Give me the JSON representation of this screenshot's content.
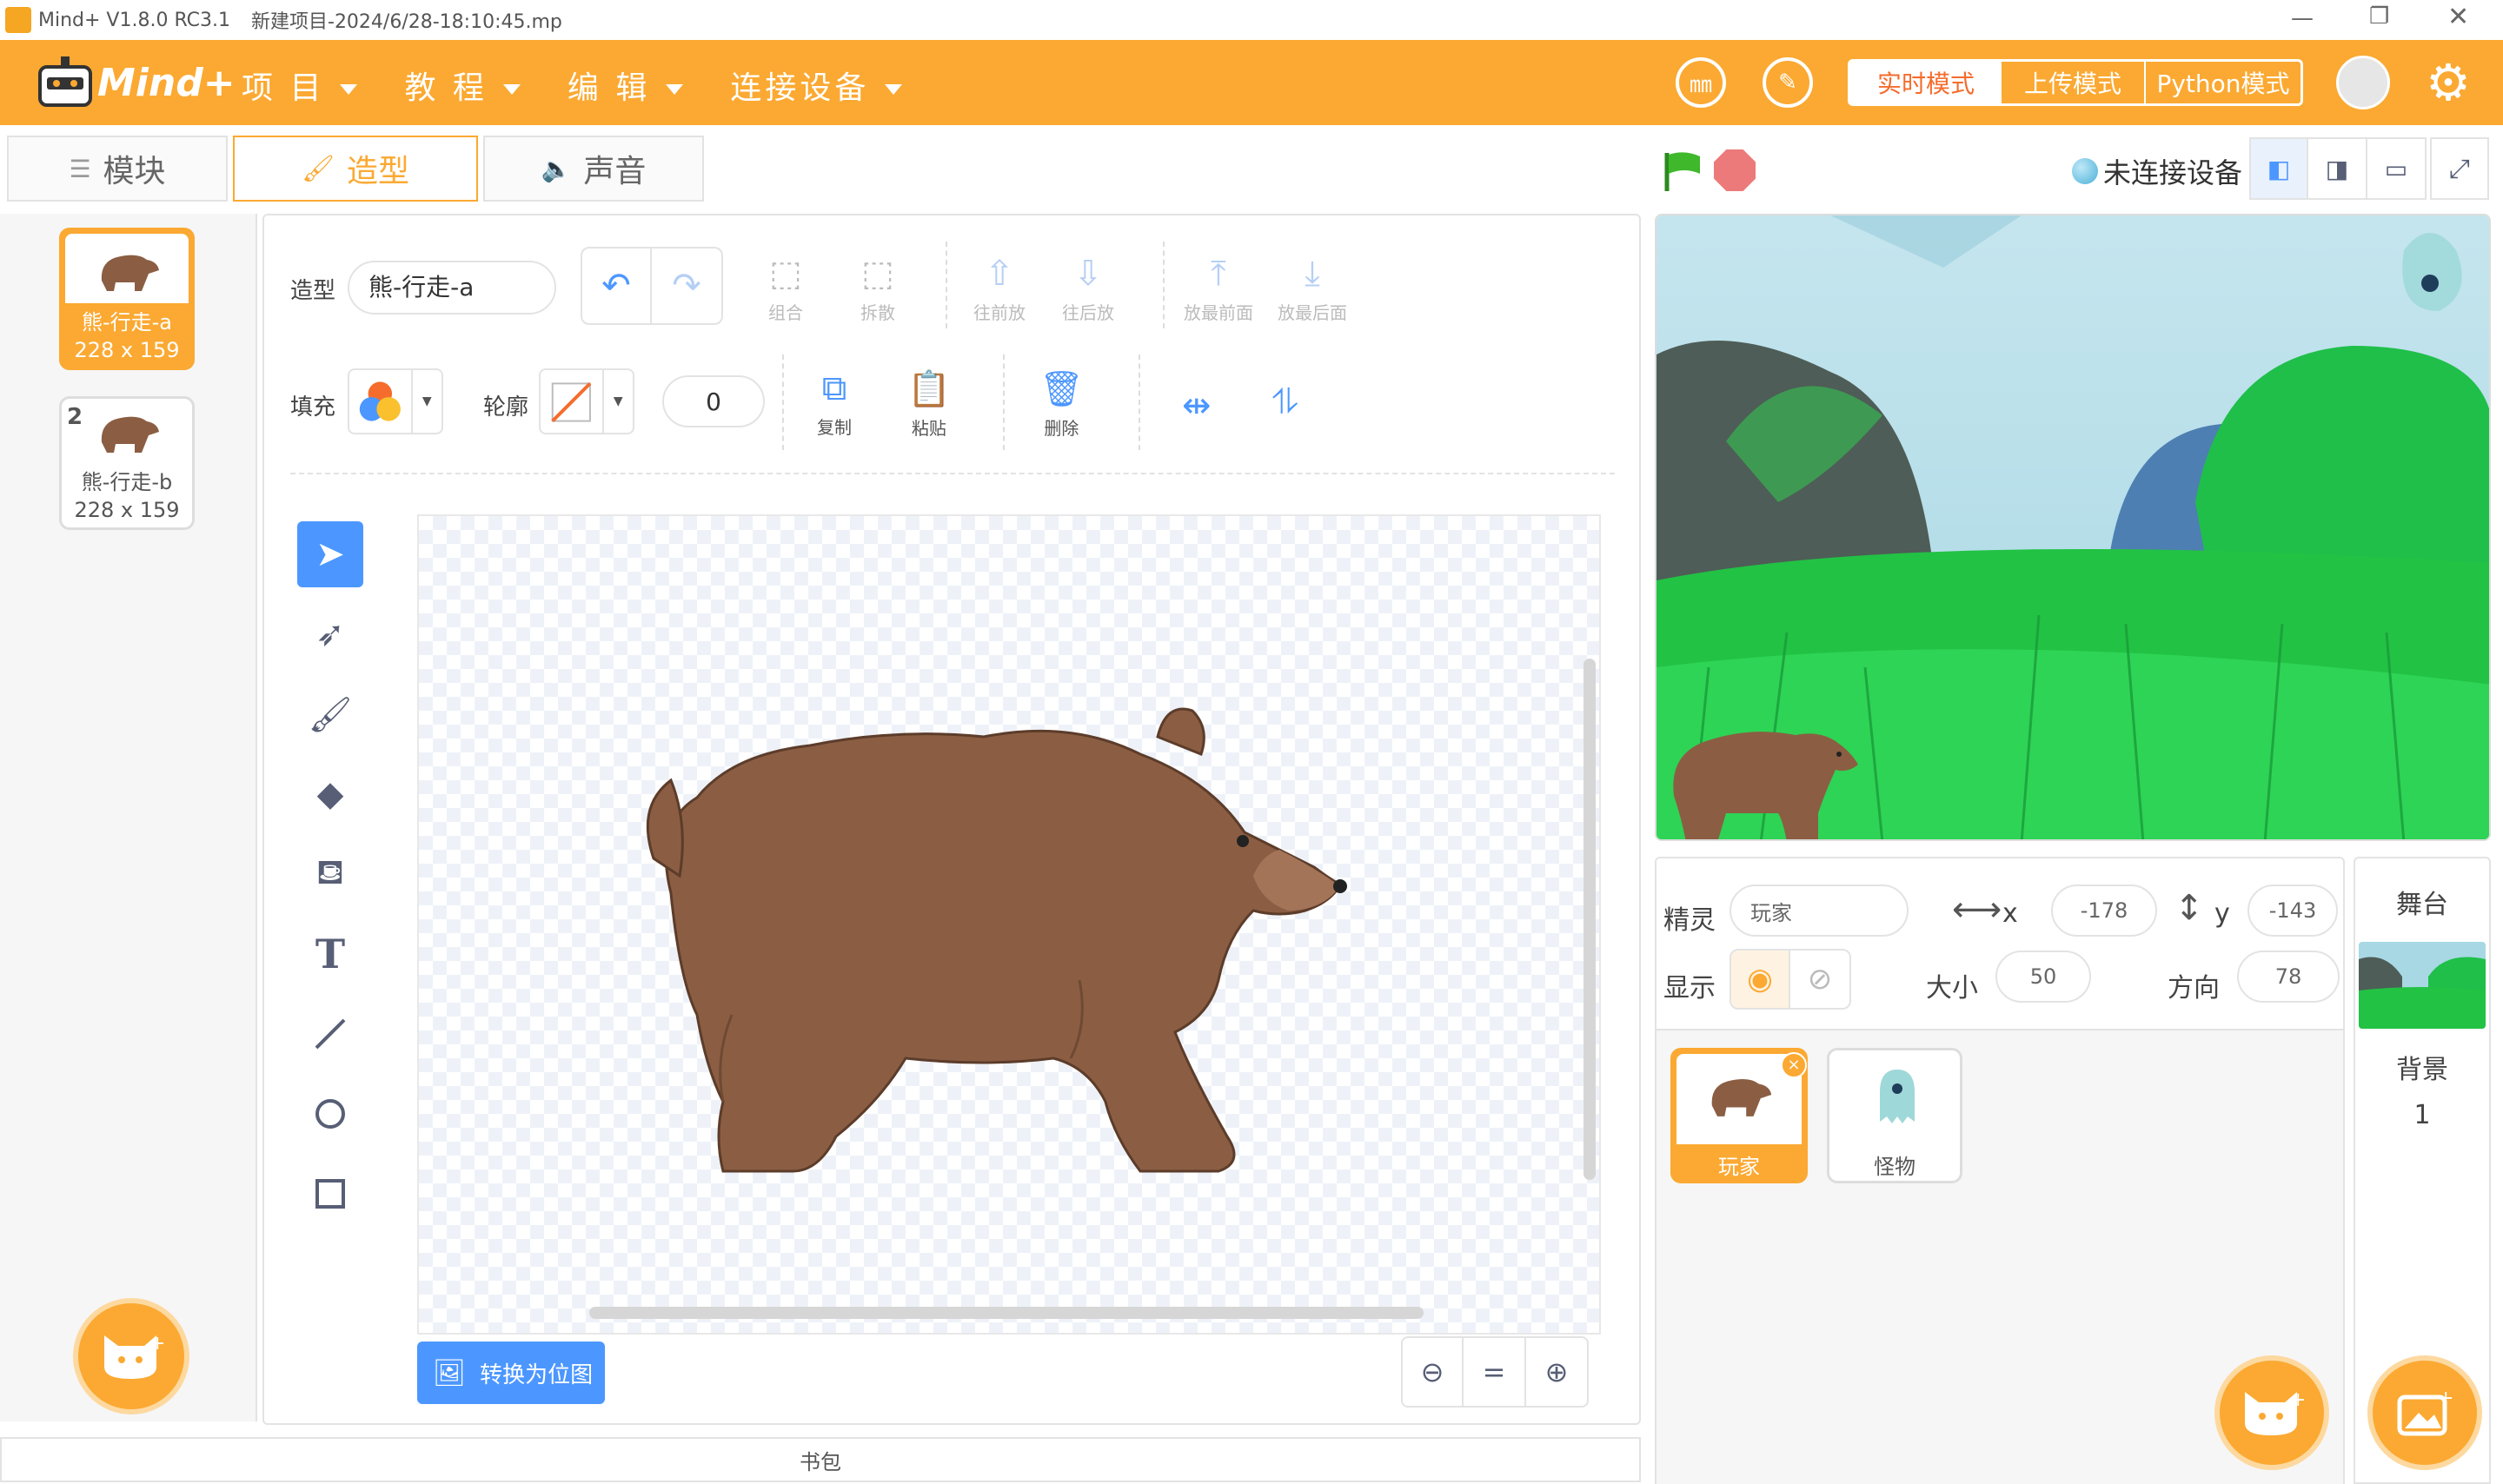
{
  "window": {
    "title": "Mind+ V1.8.0 RC3.1",
    "project": "新建项目-2024/6/28-18:10:45.mp"
  },
  "menu": {
    "logo": "Mind+",
    "items": [
      {
        "label": "项 目"
      },
      {
        "label": "教 程"
      },
      {
        "label": "编 辑"
      },
      {
        "label": "连接设备"
      }
    ],
    "modes": {
      "realtime": "实时模式",
      "upload": "上传模式",
      "python": "Python模式"
    }
  },
  "tabs": {
    "blocks": "模块",
    "costumes": "造型",
    "sounds": "声音"
  },
  "costumes": [
    {
      "index": "1",
      "name": "熊-行走-a",
      "size": "228 x 159"
    },
    {
      "index": "2",
      "name": "熊-行走-b",
      "size": "228 x 159"
    }
  ],
  "editor": {
    "costume_label": "造型",
    "costume_name": "熊-行走-a",
    "fill_label": "填充",
    "outline_label": "轮廓",
    "outline_width": "0",
    "group": "组合",
    "ungroup": "拆散",
    "forward": "往前放",
    "backward": "往后放",
    "front": "放最前面",
    "back": "放最后面",
    "copy": "复制",
    "paste": "粘贴",
    "delete": "删除",
    "convert": "转换为位图",
    "zoom_reset": "="
  },
  "stage_header": {
    "connection": "未连接设备"
  },
  "sprite_info": {
    "sprite_label": "精灵",
    "sprite_name": "玩家",
    "x_label": "x",
    "x_value": "-178",
    "y_label": "y",
    "y_value": "-143",
    "show_label": "显示",
    "size_label": "大小",
    "size_value": "50",
    "direction_label": "方向",
    "direction_value": "78"
  },
  "sprites": [
    {
      "name": "玩家"
    },
    {
      "name": "怪物"
    }
  ],
  "stage_panel": {
    "title": "舞台",
    "backdrop_label": "背景",
    "backdrop_count": "1"
  },
  "backpack": "书包",
  "colors": {
    "accent": "#fba932",
    "blue": "#4c97ff",
    "bear": "#8b5e43"
  }
}
